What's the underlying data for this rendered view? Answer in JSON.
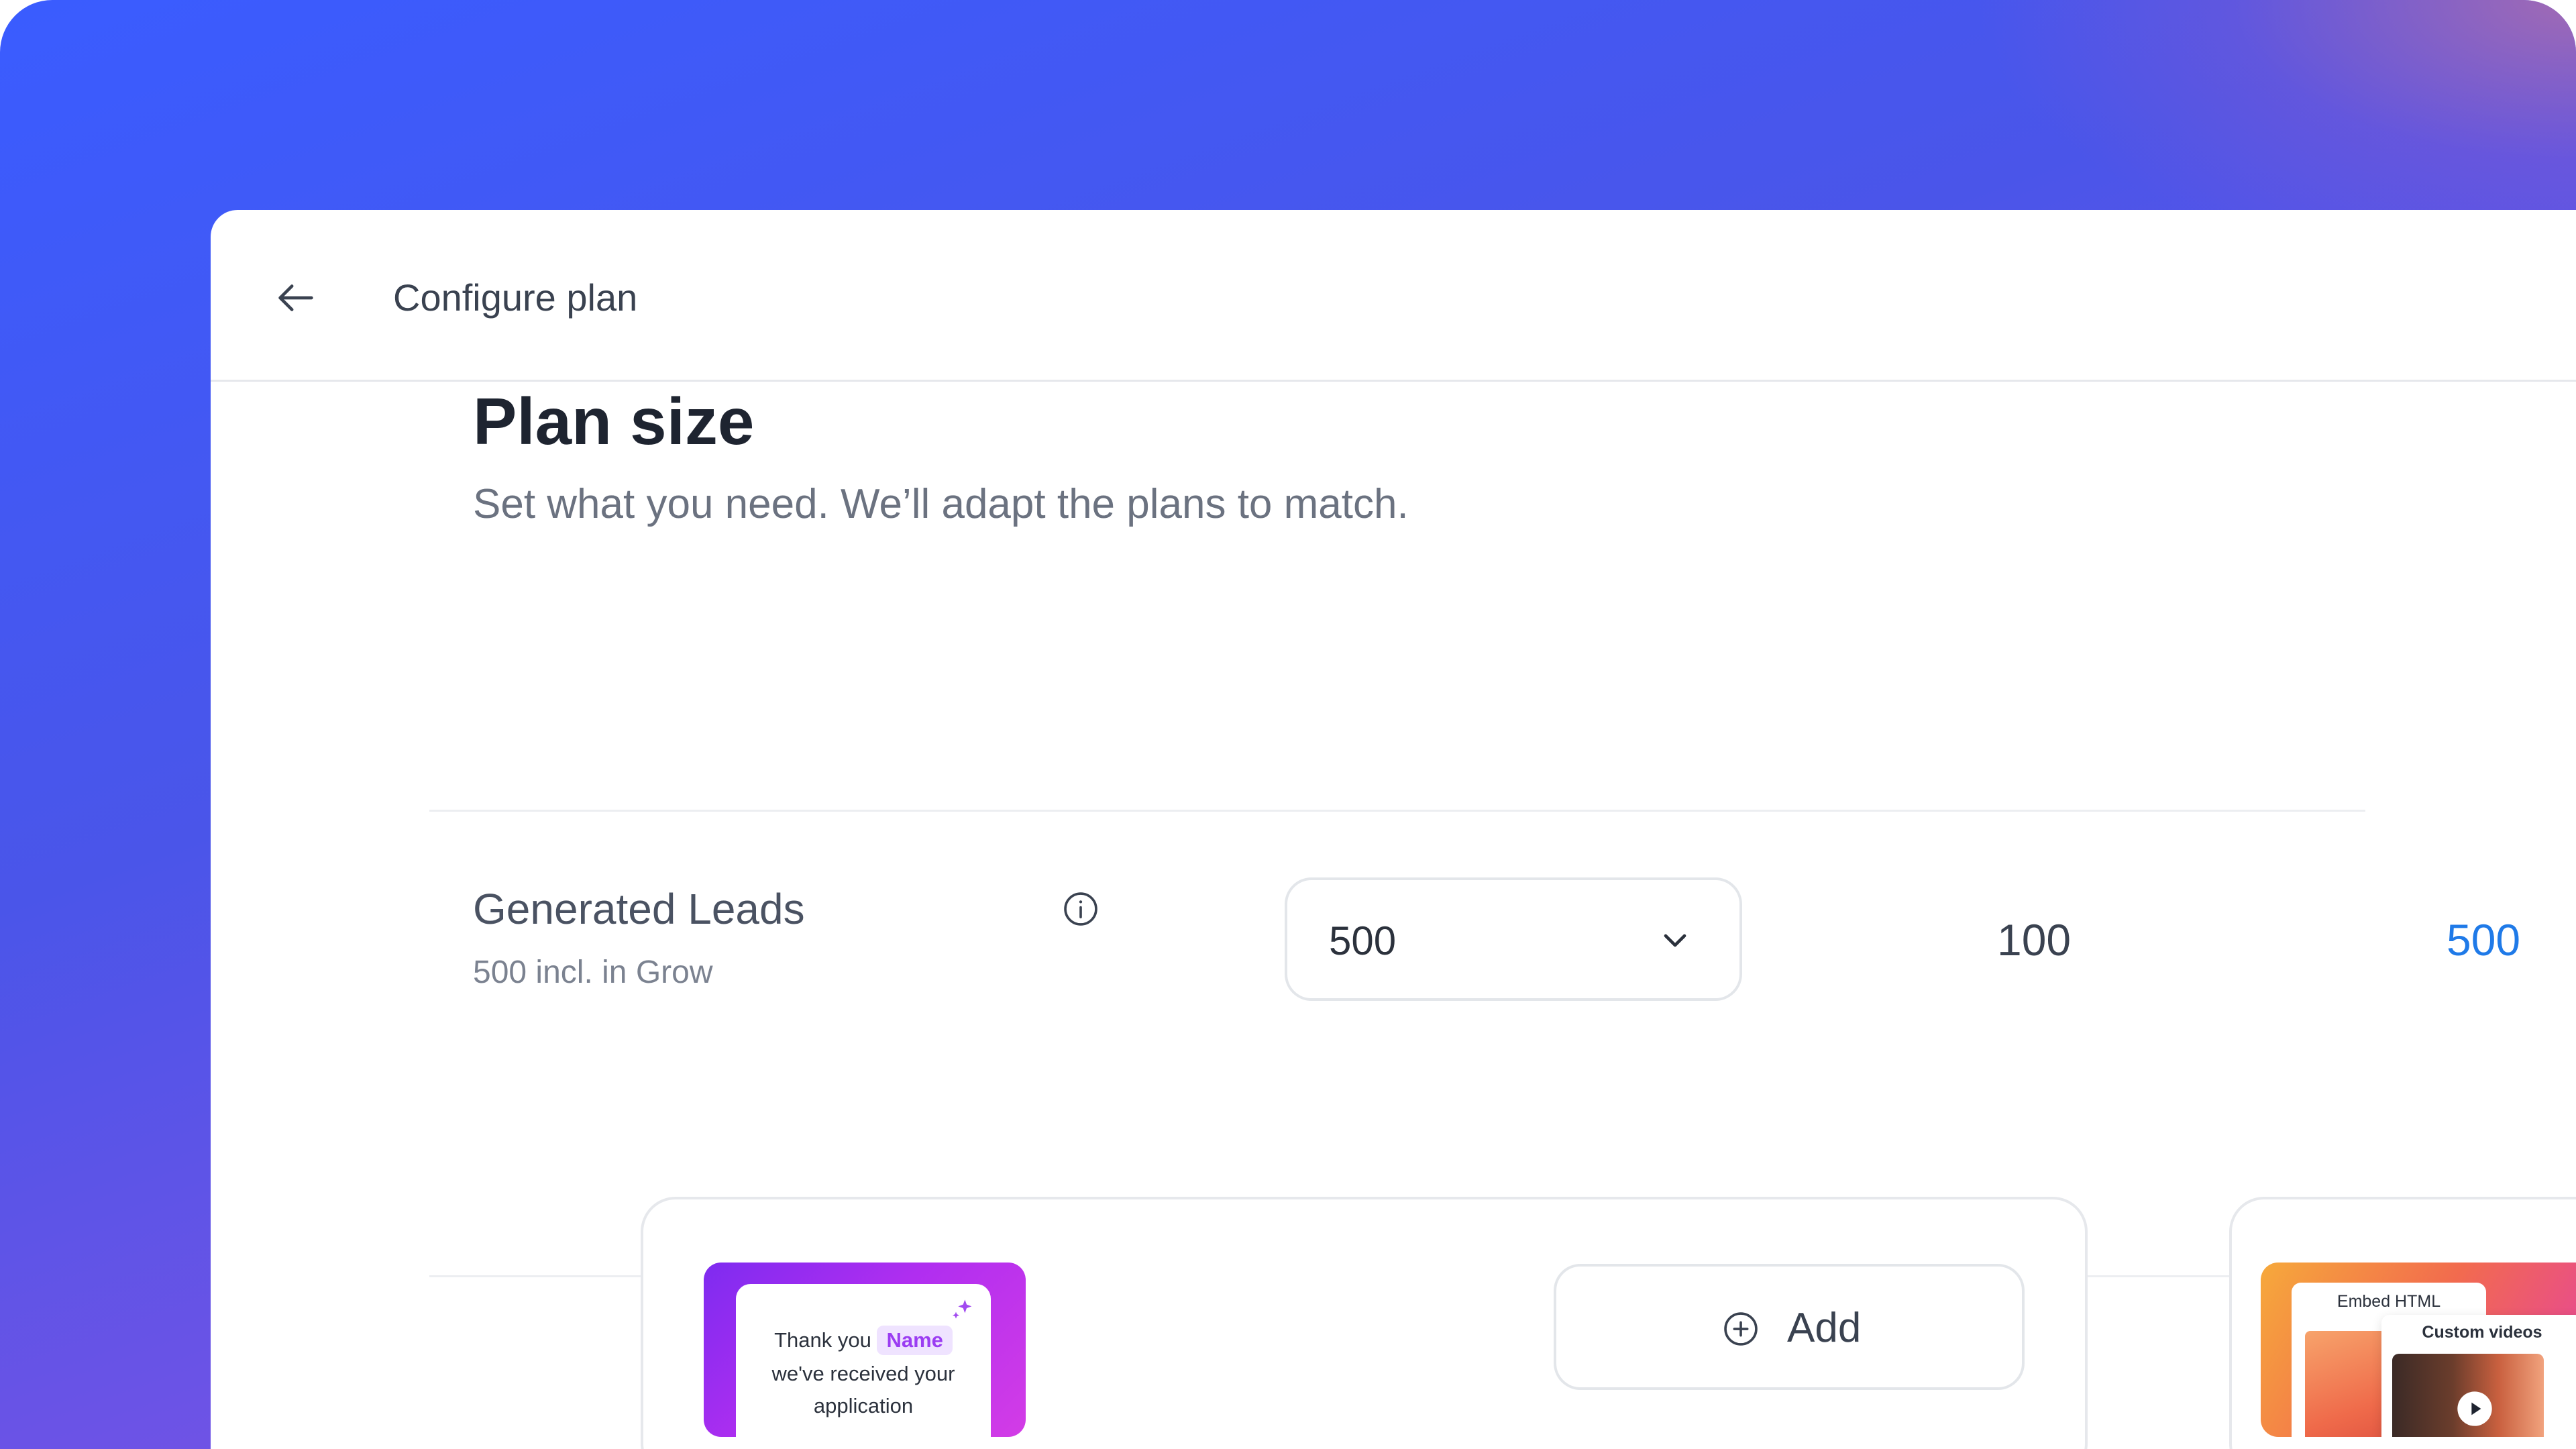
{
  "header": {
    "title": "Configure plan",
    "back_icon": "arrow-left-icon"
  },
  "plan": {
    "title": "Plan size",
    "subtitle": "Set what you need. We’ll adapt the plans to match."
  },
  "leads_row": {
    "label": "Generated Leads",
    "sublabel": "500 incl. in Grow",
    "info_icon": "info-icon",
    "select_value": "500",
    "chevron_icon": "chevron-down-icon",
    "columns": [
      {
        "value": "100",
        "color": "#3a4250"
      },
      {
        "value": "500",
        "color": "#1f7ae8"
      }
    ]
  },
  "feature_card": {
    "thumbnail": {
      "line1_prefix": "Thank you",
      "name_tag": "Name",
      "line2": "we've received your",
      "line3": "application",
      "sparkle_icon": "sparkle-icon"
    },
    "add_button": {
      "label": "Add",
      "icon": "plus-circle-icon"
    }
  },
  "feature_card_2": {
    "thumbnail": {
      "embed_label": "Embed HTML",
      "video_label": "Custom videos",
      "play_icon": "play-icon"
    }
  },
  "colors": {
    "background_gradient_start": "#3a5cff",
    "background_gradient_end": "#8b58e2",
    "accent_blue": "#1f7ae8",
    "thumb_purple": "#b02ef0",
    "name_tag_text": "#9b3df2"
  }
}
